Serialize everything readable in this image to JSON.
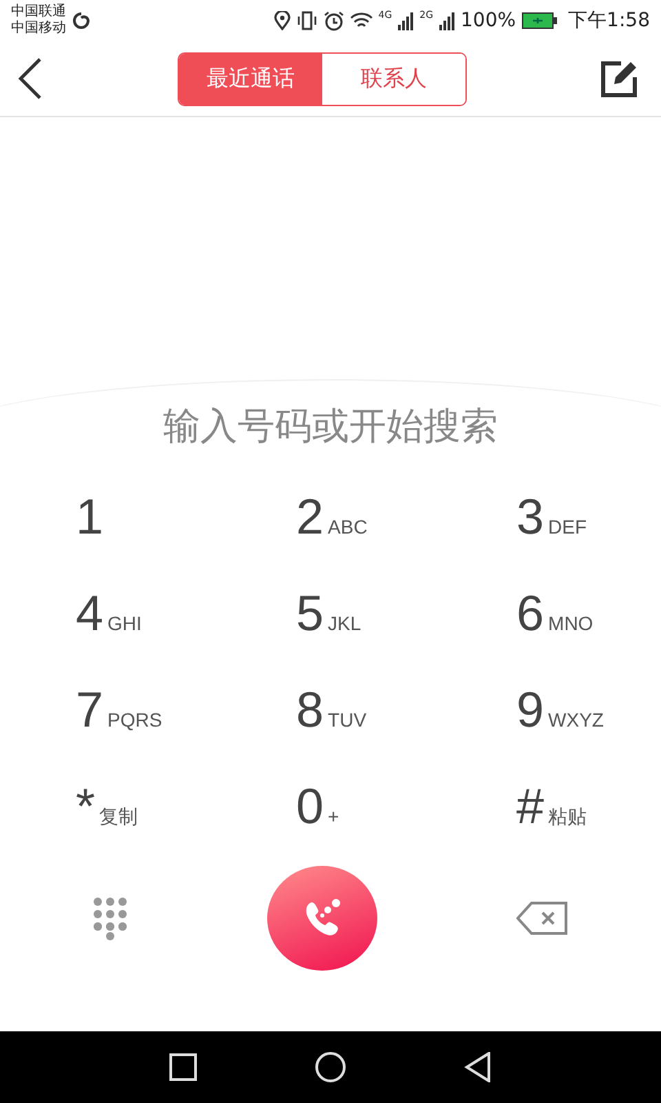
{
  "status_bar": {
    "carriers": [
      "中国联通",
      "中国移动"
    ],
    "networks": [
      "4G",
      "2G"
    ],
    "battery": "100%",
    "time": "下午1:58"
  },
  "tabs": [
    {
      "label": "最近通话",
      "selected": true
    },
    {
      "label": "联系人",
      "selected": false
    }
  ],
  "search": {
    "placeholder": "输入号码或开始搜索"
  },
  "keys": [
    {
      "main": "1"
    },
    {
      "main": "2",
      "sub": "ABC"
    },
    {
      "main": "3",
      "sub": "DEF"
    },
    {
      "main": "4",
      "sub": "GHI"
    },
    {
      "main": "5",
      "sub": "JKL"
    },
    {
      "main": "6",
      "sub": "MNO"
    },
    {
      "main": "7",
      "sub": "PQRS"
    },
    {
      "main": "8",
      "sub": "TUV"
    },
    {
      "main": "9",
      "sub": "WXYZ"
    },
    {
      "main": "*",
      "sub": "复制"
    },
    {
      "main": "0",
      "sub": "+"
    },
    {
      "main": "#",
      "sub": "粘贴"
    }
  ]
}
